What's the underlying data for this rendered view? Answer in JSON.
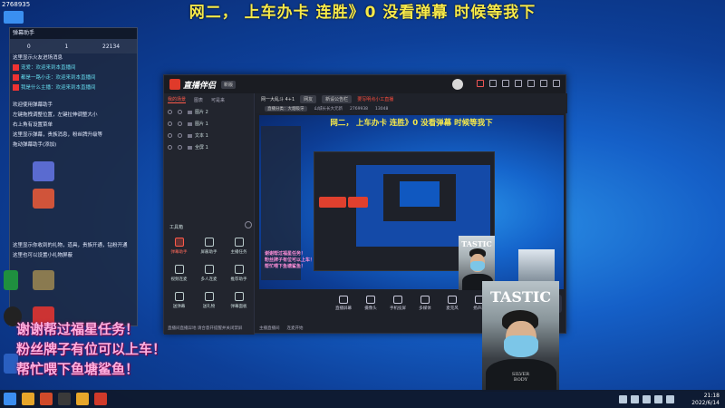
{
  "banner": "网二， 上车办卡 连胜》0  没看弹幕 时候等我下",
  "top_left": {
    "id": "2768935"
  },
  "left_panel": {
    "header": "弹幕助手",
    "stats": [
      "0",
      "1",
      "22134"
    ],
    "lines": [
      "这里显示火友进场消息",
      "宠爱：欢迎来到本直播间",
      "都是一路小走：欢迎来到本直播间",
      "我是什么主播：欢迎来到本直播间"
    ],
    "help": [
      "欢迎使用弹幕助手",
      "左键拖拽调整位置，左键拉伸调整大小",
      "右上角有设置菜单",
      "这里显示弹幕，贵族消息，粉丝牌升级等",
      "拖动弹幕助手(添加)"
    ],
    "lower": [
      "这里显示你收到的礼物，道具，贵族开通，钻粉开通",
      "这里也可以设置小礼物屏蔽"
    ]
  },
  "app": {
    "title": "直播伴侣",
    "version": "新版",
    "side_tabs": [
      "我的场景",
      "图表",
      "可是来"
    ],
    "layers": [
      "图片 2",
      "图片 1",
      "文本 1",
      "全屏 1"
    ],
    "tools_title": "工具箱",
    "tools": [
      "弹幕助手",
      "屏蔽助手",
      "主播任务",
      "视频连麦",
      "多人连麦",
      "推荐助手",
      "送弹幕",
      "送礼物",
      "弹幕面板"
    ],
    "scene_tabs": [
      "网一大乱斗 4+1",
      "网友"
    ],
    "scene_pill": "新设公告栏",
    "scene_warning": "要写明点小工直播",
    "scene_info": [
      "直播分类：大烟吸牙",
      "山城长长大元新",
      "2769938",
      "13048"
    ],
    "preview_banner": "网二， 上车办卡 连胜》0  没看弹幕 时候等我下",
    "preview_pink": [
      "谢谢帮过福星任务！",
      "粉丝牌子有位可以上车！",
      "帮忙喂下鱼塘鲨鱼！"
    ],
    "bottom_ctrls": [
      "直播屏幕",
      "摄像头",
      "手机投屏",
      "多媒体",
      "麦克风",
      "扬声器"
    ],
    "status": [
      "主播直播间",
      "连麦开始"
    ],
    "side_status": "直播间直播异地 请合意开提醒并关闭禁屏"
  },
  "cam_big": {
    "word": "TASTIC",
    "foot": [
      "SILVER",
      "BODY"
    ]
  },
  "cam_small": {
    "word": "TASTIC"
  },
  "pink_overlay": [
    "谢谢帮过福星任务！",
    "粉丝牌子有位可以上车！",
    "帮忙喂下鱼塘鲨鱼！"
  ],
  "taskbar": {
    "time": "21:18",
    "date": "2022/6/14"
  }
}
